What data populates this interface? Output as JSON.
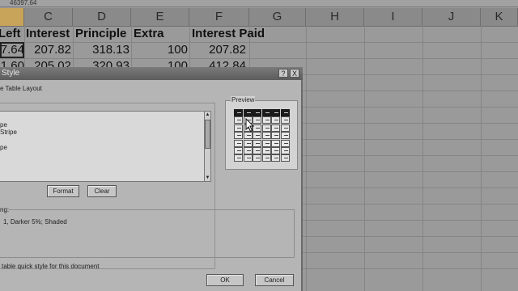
{
  "formula_bar": {
    "value": "46397.64"
  },
  "columns": [
    "",
    "C",
    "D",
    "E",
    "F",
    "G",
    "H",
    "I",
    "J",
    "K"
  ],
  "headers": {
    "left": "Left",
    "interest": "Interest",
    "principle": "Principle",
    "extra": "Extra",
    "interest_paid": "Interest Paid"
  },
  "row1": {
    "left": "7.64",
    "interest": "207.82",
    "principle": "318.13",
    "extra": "100",
    "interest_paid": "207.82"
  },
  "row2": {
    "left": "1.60",
    "interest": "205.02",
    "principle": "320.93",
    "extra": "100",
    "interest_paid": "412.84"
  },
  "dialog": {
    "title": "Style",
    "help_button": "?",
    "close_button": "X",
    "subtitle": "e Table Layout",
    "preview_label": "Preview",
    "elements": [
      "pe",
      "Stripe",
      "",
      "pe"
    ],
    "format_button": "Format",
    "clear_button": "Clear",
    "description_label": "ng:",
    "description_text": "1, Darker 5%; Shaded",
    "default_checkbox_label": "table quick style for this document",
    "ok_button": "OK",
    "cancel_button": "Cancel"
  }
}
